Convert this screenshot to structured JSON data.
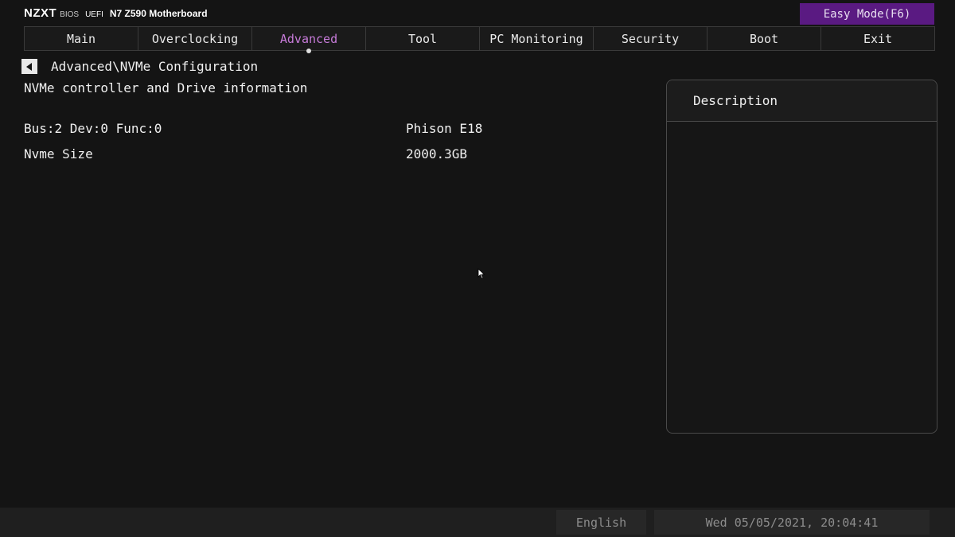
{
  "header": {
    "logo": "NZXT",
    "bios_label": "BIOS",
    "uefi_label": "UEFI",
    "model": "N7 Z590 Motherboard",
    "easy_mode_label": "Easy Mode(F6)",
    "easy_mode_color": "#5a1a82"
  },
  "tabs": [
    {
      "label": "Main",
      "active": false
    },
    {
      "label": "Overclocking",
      "active": false
    },
    {
      "label": "Advanced",
      "active": true
    },
    {
      "label": "Tool",
      "active": false
    },
    {
      "label": "PC Monitoring",
      "active": false
    },
    {
      "label": "Security",
      "active": false
    },
    {
      "label": "Boot",
      "active": false
    },
    {
      "label": "Exit",
      "active": false
    }
  ],
  "accent_color": "#c77bd9",
  "breadcrumb": "Advanced\\NVMe Configuration",
  "back_icon": "back-arrow-icon",
  "section_title": "NVMe controller and Drive information",
  "rows": [
    {
      "label": "Bus:2 Dev:0 Func:0",
      "value": "Phison E18"
    },
    {
      "label": "Nvme Size",
      "value": "2000.3GB"
    }
  ],
  "description": {
    "title": "Description",
    "body": ""
  },
  "footer": {
    "language": "English",
    "datetime": "Wed 05/05/2021, 20:04:41"
  }
}
